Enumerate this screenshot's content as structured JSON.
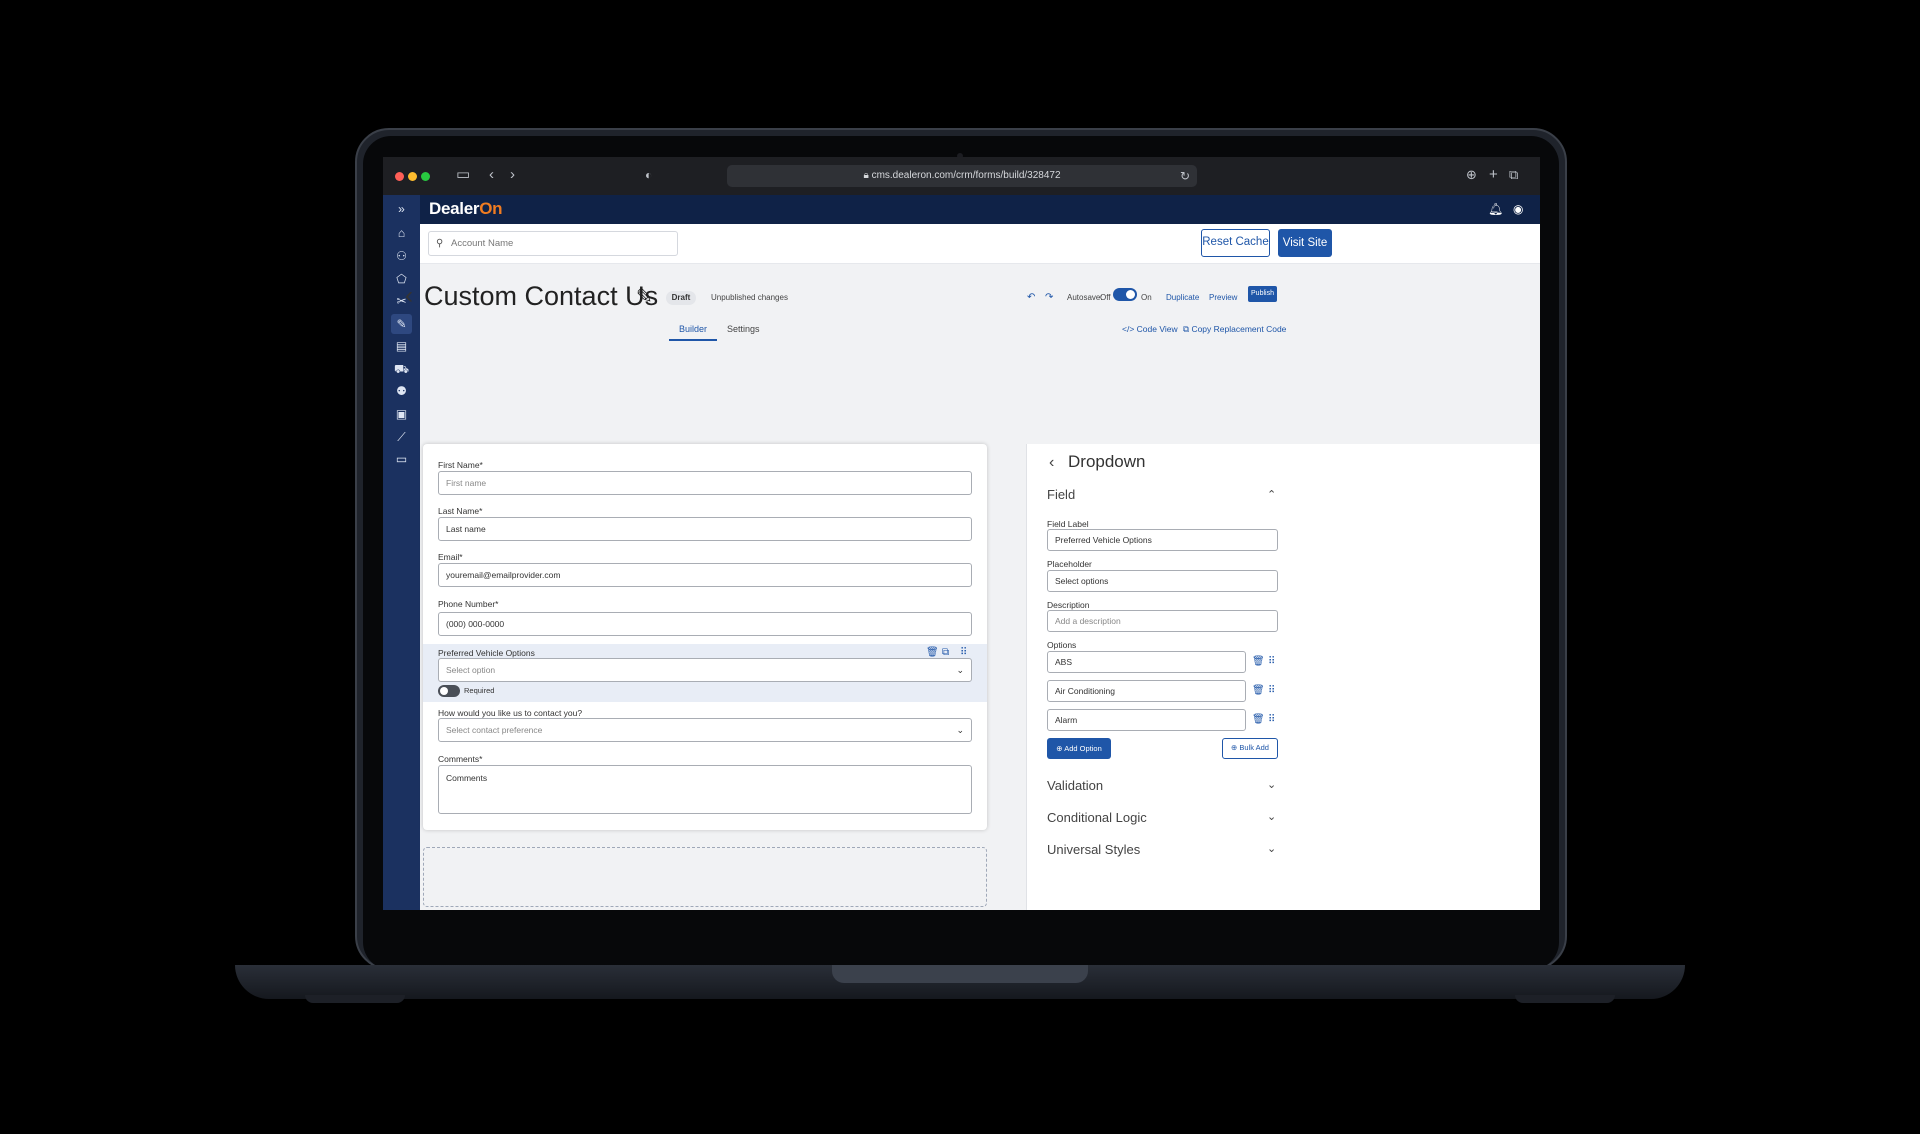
{
  "browser": {
    "url": "cms.dealeron.com/crm/forms/build/328472"
  },
  "app": {
    "logo_text": "Dealer",
    "logo_accent": "On"
  },
  "toolbar": {
    "search_placeholder": "Account Name",
    "reset_cache": "Reset Cache",
    "visit_site": "Visit Site"
  },
  "page": {
    "title": "Custom Contact Us",
    "status": "Draft",
    "unpublished": "Unpublished changes",
    "autosave_label": "Autosave:",
    "autosave_off": "Off",
    "autosave_on": "On",
    "duplicate": "Duplicate",
    "preview": "Preview",
    "publish": "Publish"
  },
  "tabs": {
    "builder": "Builder",
    "settings": "Settings",
    "code_view": "Code View",
    "copy_code": "Copy Replacement Code"
  },
  "form": {
    "first_name_label": "First Name*",
    "first_name_ph": "First name",
    "last_name_label": "Last Name*",
    "last_name_ph": "Last name",
    "email_label": "Email*",
    "email_ph": "youremail@emailprovider.com",
    "phone_label": "Phone Number*",
    "phone_ph": "(000) 000-0000",
    "vehicle_label": "Preferred Vehicle Options",
    "vehicle_ph": "Select option",
    "required_label": "Required",
    "contact_label": "How would you like us to contact you?",
    "contact_ph": "Select contact preference",
    "comments_label": "Comments*",
    "comments_ph": "Comments"
  },
  "panel": {
    "title": "Dropdown",
    "field_section": "Field",
    "field_label_label": "Field Label",
    "field_label_value": "Preferred Vehicle Options",
    "placeholder_label": "Placeholder",
    "placeholder_value": "Select options",
    "description_label": "Description",
    "description_ph": "Add a description",
    "options_label": "Options",
    "options": [
      "ABS",
      "Air Conditioning",
      "Alarm"
    ],
    "add_option": "Add Option",
    "bulk_add": "Bulk Add",
    "validation": "Validation",
    "conditional_logic": "Conditional Logic",
    "universal_styles": "Universal Styles"
  },
  "colors": {
    "brand_navy": "#0f2247",
    "sidebar": "#1b3160",
    "accent_blue": "#1f56a8",
    "logo_orange": "#f07c21"
  }
}
